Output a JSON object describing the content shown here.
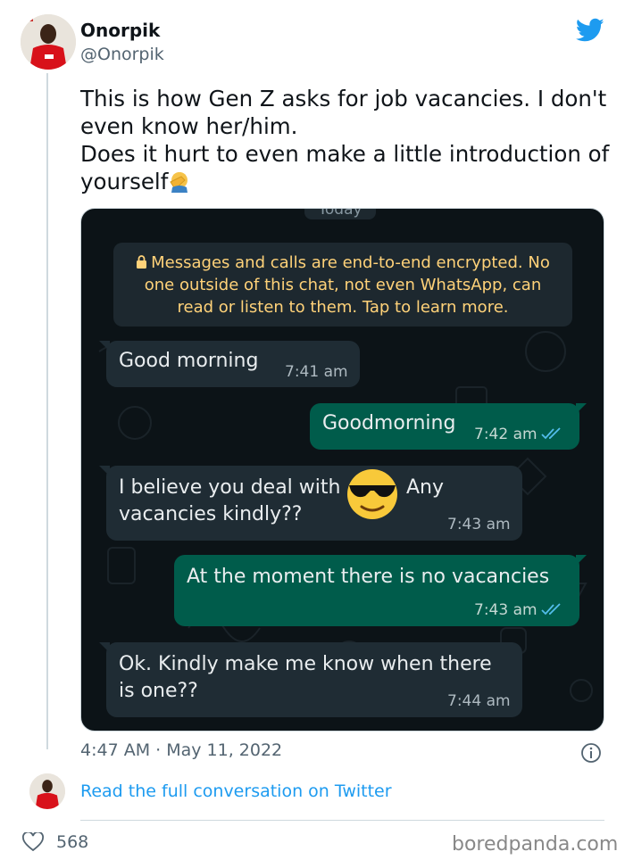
{
  "author": {
    "name": "Onorpik",
    "handle": "@Onorpik"
  },
  "tweet": {
    "line1": "This is how Gen Z asks for job vacancies. I don't even know her/him.",
    "line2": "Does it hurt to even make a little introduction of yourself",
    "timestamp": "4:47 AM · May 11, 2022",
    "read_more": "Read the full conversation on Twitter",
    "likes": "568"
  },
  "chat": {
    "date_chip": "Today",
    "encryption_notice": "Messages and calls are end-to-end encrypted. No one outside of this chat, not even WhatsApp, can read or listen to them. Tap to learn more.",
    "messages": [
      {
        "direction": "in",
        "text": "Good morning",
        "time": "7:41 am"
      },
      {
        "direction": "out",
        "text": "Goodmorning",
        "time": "7:42 am"
      },
      {
        "direction": "in",
        "text_a": "I believe you deal with",
        "text_b": "Any",
        "text_c": "vacancies kindly??",
        "time": "7:43 am"
      },
      {
        "direction": "out",
        "text": "At the moment there is no vacancies",
        "time": "7:43 am"
      },
      {
        "direction": "in",
        "text_a": "Ok. Kindly make me know when there",
        "text_b": "is one??",
        "time": "7:44 am"
      }
    ]
  },
  "watermark": "boredpanda.com",
  "colors": {
    "twitter_blue": "#1d9bf0",
    "wa_incoming": "#1f2c34",
    "wa_outgoing": "#005c4b",
    "wa_background": "#0c1317",
    "encryption_text": "#ffd279",
    "read_ticks": "#53bdeb"
  },
  "icons": [
    "twitter-bird-icon",
    "facepalm-emoji-icon",
    "lock-icon",
    "double-check-icon",
    "sunglasses-emoji-icon",
    "info-icon",
    "heart-icon"
  ]
}
